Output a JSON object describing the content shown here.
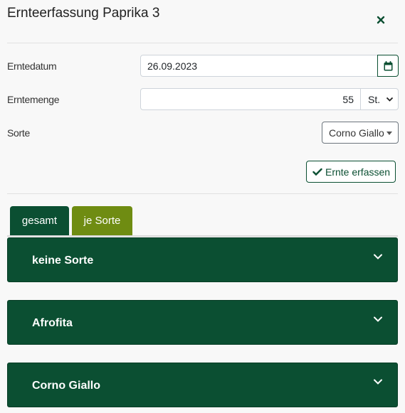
{
  "header": {
    "title": "Ernteerfassung Paprika 3",
    "close_icon": "close-icon"
  },
  "form": {
    "date_label": "Erntedatum",
    "date_value": "26.09.2023",
    "amount_label": "Erntemenge",
    "amount_value": "55",
    "unit_value": "St.",
    "variety_label": "Sorte",
    "variety_value": "Corno Giallo",
    "submit_label": "Ernte erfassen"
  },
  "tabs": [
    {
      "label": "gesamt"
    },
    {
      "label": "je Sorte"
    }
  ],
  "panels": [
    {
      "title": "keine Sorte"
    },
    {
      "title": "Afrofita"
    },
    {
      "title": "Corno Giallo"
    }
  ],
  "colors": {
    "primary": "#0b4f32",
    "tab_active": "#6f8c12",
    "background": "#f8f8f8"
  }
}
